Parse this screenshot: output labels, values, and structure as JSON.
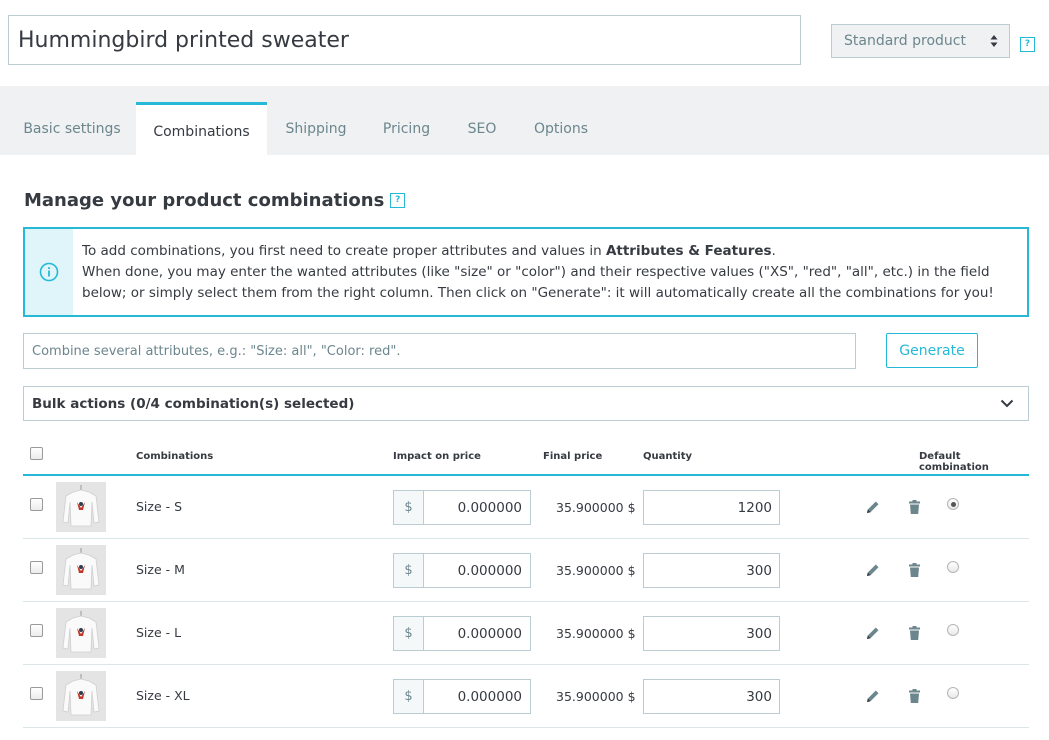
{
  "product": {
    "name": "Hummingbird printed sweater",
    "type_select": "Standard product",
    "help": "?"
  },
  "tabs": [
    {
      "label": "Basic settings"
    },
    {
      "label": "Combinations"
    },
    {
      "label": "Shipping"
    },
    {
      "label": "Pricing"
    },
    {
      "label": "SEO"
    },
    {
      "label": "Options"
    }
  ],
  "combinations_section": {
    "title": "Manage your product combinations",
    "help": "?",
    "info_line1_prefix": "To add combinations, you first need to create proper attributes and values in ",
    "info_line1_bold": "Attributes & Features",
    "info_line1_suffix": ".",
    "info_line2": "When done, you may enter the wanted attributes (like \"size\" or \"color\") and their respective values (\"XS\", \"red\", \"all\", etc.) in the field below; or simply select them from the right column. Then click on \"Generate\": it will automatically create all the combinations for you!",
    "combine_placeholder": "Combine several attributes, e.g.: \"Size: all\", \"Color: red\".",
    "generate_label": "Generate",
    "bulk_actions_label": "Bulk actions (0/4 combination(s) selected)"
  },
  "table": {
    "headers": {
      "combinations": "Combinations",
      "impact_on_price": "Impact on price",
      "final_price": "Final price",
      "quantity": "Quantity",
      "default_combination": "Default combination"
    },
    "rows": [
      {
        "name": "Size - S",
        "currency": "$",
        "impact": "0.000000",
        "final_price": "35.900000 $",
        "quantity": "1200",
        "default": true
      },
      {
        "name": "Size - M",
        "currency": "$",
        "impact": "0.000000",
        "final_price": "35.900000 $",
        "quantity": "300",
        "default": false
      },
      {
        "name": "Size - L",
        "currency": "$",
        "impact": "0.000000",
        "final_price": "35.900000 $",
        "quantity": "300",
        "default": false
      },
      {
        "name": "Size - XL",
        "currency": "$",
        "impact": "0.000000",
        "final_price": "35.900000 $",
        "quantity": "300",
        "default": false
      }
    ]
  },
  "colors": {
    "accent": "#25b9d7",
    "text": "#363a41",
    "muted": "#6c868e",
    "border": "#bbcdd2"
  }
}
